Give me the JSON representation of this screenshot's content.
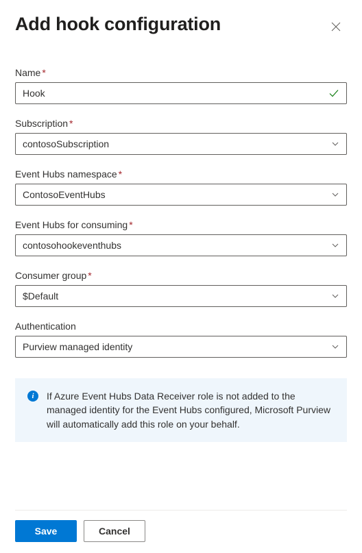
{
  "header": {
    "title": "Add hook configuration"
  },
  "fields": {
    "name": {
      "label": "Name",
      "value": "Hook",
      "required": true,
      "validated": true
    },
    "subscription": {
      "label": "Subscription",
      "value": "contosoSubscription",
      "required": true
    },
    "eventHubsNamespace": {
      "label": "Event Hubs namespace",
      "value": "ContosoEventHubs",
      "required": true
    },
    "eventHubsConsuming": {
      "label": "Event Hubs for consuming",
      "value": "contosohookeventhubs",
      "required": true
    },
    "consumerGroup": {
      "label": "Consumer group",
      "value": "$Default",
      "required": true
    },
    "authentication": {
      "label": "Authentication",
      "value": "Purview managed identity",
      "required": false
    }
  },
  "infoMessage": "If Azure Event Hubs Data Receiver role is not added to the managed identity for the Event Hubs configured, Microsoft Purview will automatically add this role on your behalf.",
  "buttons": {
    "save": "Save",
    "cancel": "Cancel"
  }
}
